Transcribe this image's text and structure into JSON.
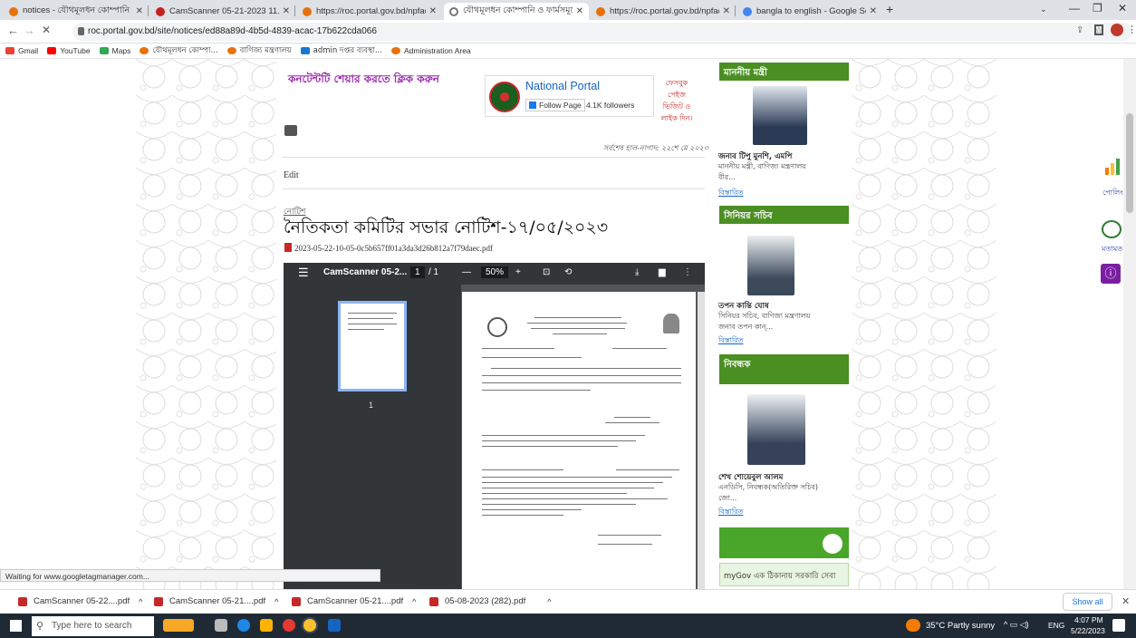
{
  "browser": {
    "tabs": [
      {
        "label": "notices - যৌথমূলধন কোম্পানি ও",
        "color": "#e8710a",
        "active": false
      },
      {
        "label": "CamScanner 05-21-2023 11.10.p",
        "color": "#c5221f",
        "active": false
      },
      {
        "label": "https://roc.portal.gov.bd/npfadn",
        "color": "#e8710a",
        "active": false
      },
      {
        "label": "যৌথমূলধন কোম্পানি ও ফার্মসমূহে",
        "color": "#999999",
        "active": true
      },
      {
        "label": "https://roc.portal.gov.bd/npfadn",
        "color": "#e8710a",
        "active": false
      },
      {
        "label": "bangla to english - Google Searc",
        "color": "#4285f4",
        "active": false
      }
    ],
    "url": "roc.portal.gov.bd/site/notices/ed88a89d-4b5d-4839-acac-17b622cda066",
    "bookmarks": [
      {
        "label": "Gmail",
        "color": "#ea4335"
      },
      {
        "label": "YouTube",
        "color": "#ff0000"
      },
      {
        "label": "Maps",
        "color": "#34a853"
      },
      {
        "label": "যৌথমূলধন কোম্পা...",
        "color": "#e8710a"
      },
      {
        "label": "বাণিজ্য মন্ত্রণালয়",
        "color": "#e8710a"
      },
      {
        "label": "admin দপ্তর ব্যবস্থা...",
        "color": "#1976d2"
      },
      {
        "label": "Administration Area",
        "color": "#e8710a"
      }
    ]
  },
  "content": {
    "share_text": "কনটেন্টটি শেয়ার করতে ক্লিক করুন",
    "portal_title": "National Portal",
    "follow_label": "Follow Page",
    "followers": "4.1K followers",
    "fb_note": "ফেসবুক পেইজ ভিজিট ও লাইক দিন।",
    "last_updated": "সর্বশেষ হাল-নাগাদ: ২২শে মে ২০২৩",
    "edit_label": "Edit",
    "category": "নোটিশ",
    "title": "নৈতিকতা কমিটির সভার নোটিশ-১৭/০৫/২০২৩",
    "pdf_name": "2023-05-22-10-05-0c5b657ff01a3da3d26b812a7f79daec.pdf"
  },
  "viewer": {
    "doc_name": "CamScanner 05-2...",
    "page": "1",
    "total": "/ 1",
    "zoom": "50%",
    "thumb_label": "1"
  },
  "sidebar": {
    "sections": [
      {
        "heading": "মাননীয় মন্ত্রী",
        "name": "জনাব টিপু মুনশি, এমপি",
        "desc": "মাননীয় মন্ত্রী, বাণিজ্য মন্ত্রণালয়",
        "extra": "বীর...",
        "more": "বিস্তারিত"
      },
      {
        "heading": "সিনিয়র সচিব",
        "name": "তপন কান্তি ঘোষ",
        "desc": "সিনিয়র সচিব, বাণিজ্য মন্ত্রণালয়",
        "extra": "জনাব তপন কান্...",
        "more": "বিস্তারিত"
      },
      {
        "heading": "নিবন্ধক",
        "name": "শেখ শোয়েবুল আলম",
        "desc": "এনডিসি, নিবন্ধক(অতিরিক্ত সচিব)",
        "extra": "জো...",
        "more": "বিস্তারিত"
      }
    ],
    "mygov_text": "myGov  এক ঠিকানায় সরকারি সেবা"
  },
  "floating": {
    "poll": "পোলিং",
    "feedback": "মতামত"
  },
  "status": "Waiting for www.googletagmanager.com...",
  "downloads": [
    {
      "label": "CamScanner 05-22....pdf"
    },
    {
      "label": "CamScanner 05-21....pdf"
    },
    {
      "label": "CamScanner 05-21....pdf"
    },
    {
      "label": "05-08-2023 (282).pdf"
    }
  ],
  "show_all": "Show all",
  "taskbar": {
    "search": "Type here to search",
    "weather": "35°C  Partly sunny",
    "lang": "ENG",
    "time": "4:07 PM",
    "date": "5/22/2023"
  }
}
